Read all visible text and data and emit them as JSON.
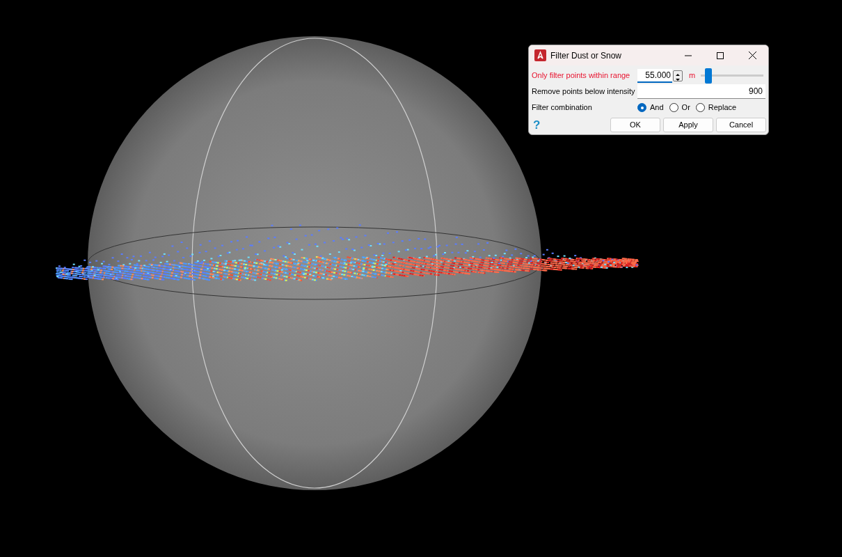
{
  "dialog": {
    "title": "Filter Dust or Snow",
    "range": {
      "label": "Only filter points within range",
      "warning": true,
      "value": "55.000",
      "unit": "m",
      "level": 0.12
    },
    "intensity": {
      "label": "Remove points below intensity",
      "value": "900"
    },
    "combination": {
      "label": "Filter combination",
      "options": [
        {
          "label": "And",
          "selected": true
        },
        {
          "label": "Or",
          "selected": false
        },
        {
          "label": "Replace",
          "selected": false
        }
      ]
    },
    "help": "?",
    "buttons": [
      "OK",
      "Apply",
      "Cancel"
    ]
  }
}
